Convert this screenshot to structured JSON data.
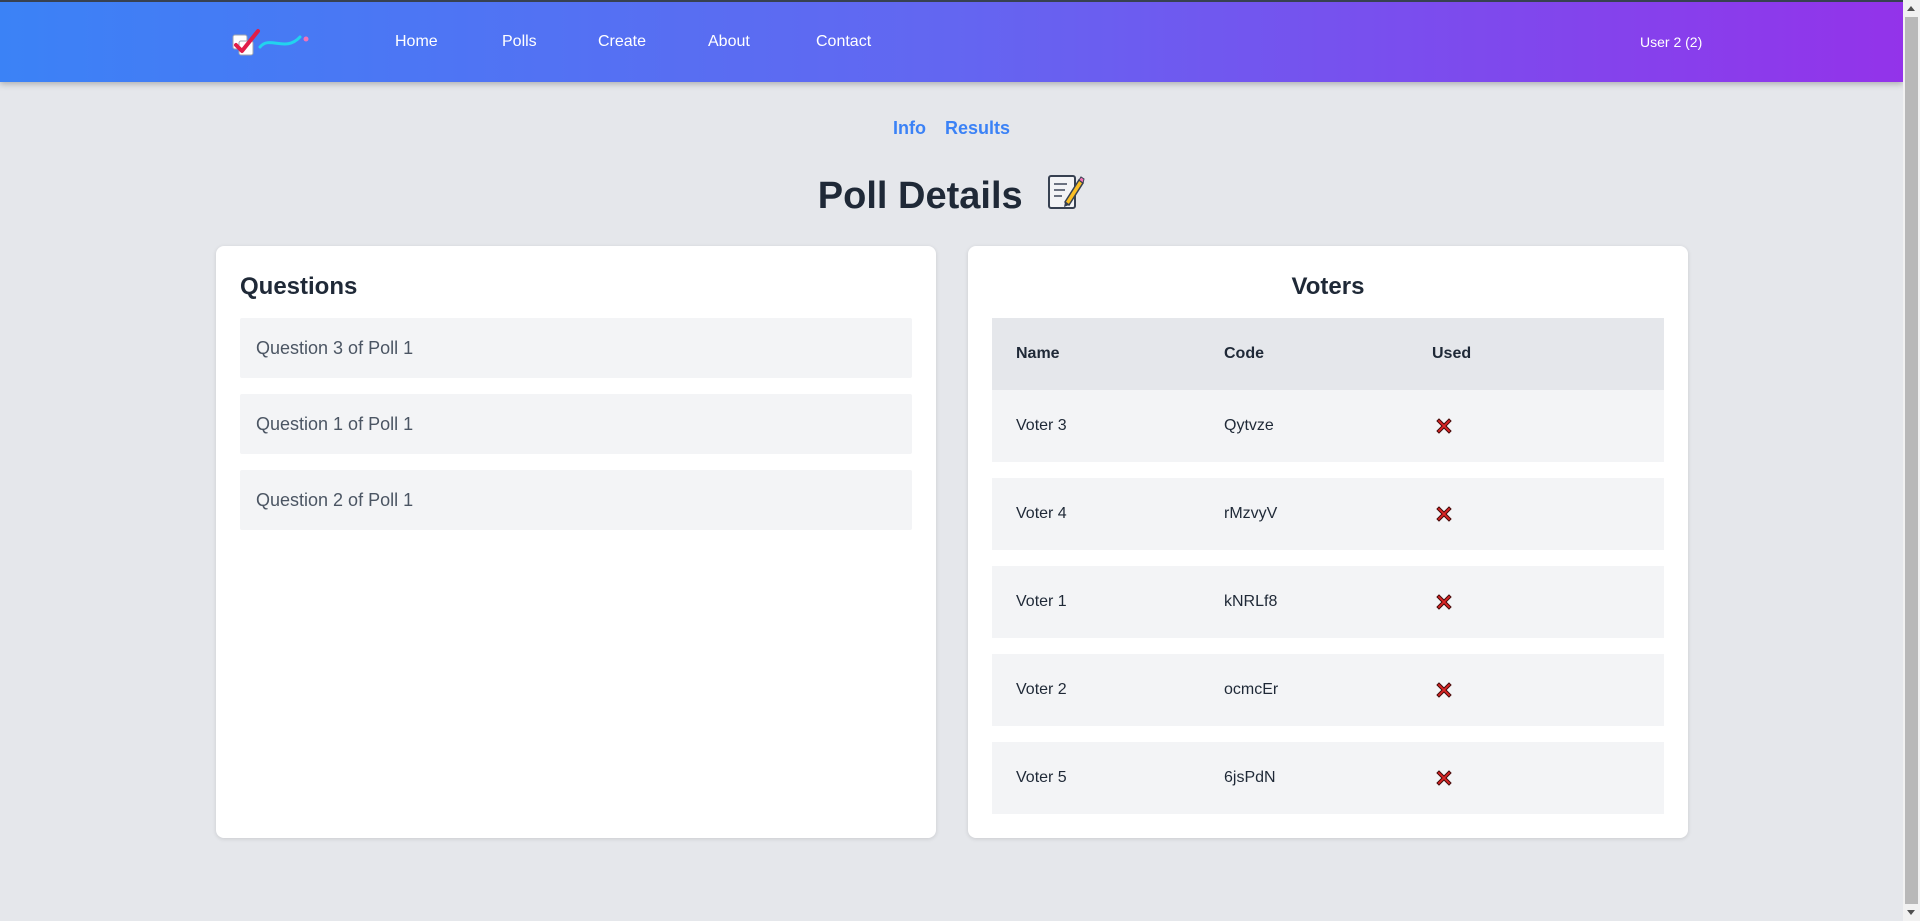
{
  "header": {
    "nav": [
      {
        "label": "Home"
      },
      {
        "label": "Polls"
      },
      {
        "label": "Create"
      },
      {
        "label": "About"
      },
      {
        "label": "Contact"
      }
    ],
    "user_label": "User 2  (2)"
  },
  "subnav": {
    "info_label": "Info",
    "results_label": "Results"
  },
  "page": {
    "title": "Poll Details"
  },
  "questions": {
    "title": "Questions",
    "items": [
      "Question 3 of Poll 1",
      "Question 1 of Poll 1",
      "Question 2 of Poll 1"
    ]
  },
  "voters": {
    "title": "Voters",
    "columns": [
      "Name",
      "Code",
      "Used"
    ],
    "rows": [
      {
        "name": "Voter 3",
        "code": "Qytvze",
        "used": false
      },
      {
        "name": "Voter 4",
        "code": "rMzvyV",
        "used": false
      },
      {
        "name": "Voter 1",
        "code": "kNRLf8",
        "used": false
      },
      {
        "name": "Voter 2",
        "code": "ocmcEr",
        "used": false
      },
      {
        "name": "Voter 5",
        "code": "6jsPdN",
        "used": false
      }
    ]
  },
  "colors": {
    "header_gradient_start": "#3b82f6",
    "header_gradient_end": "#9333ea",
    "link": "#3b82f6",
    "unused_mark": "#dc2626"
  },
  "icons": {
    "logo": "app-logo",
    "title_icon": "memo-icon",
    "used_false": "cross-mark-icon"
  }
}
